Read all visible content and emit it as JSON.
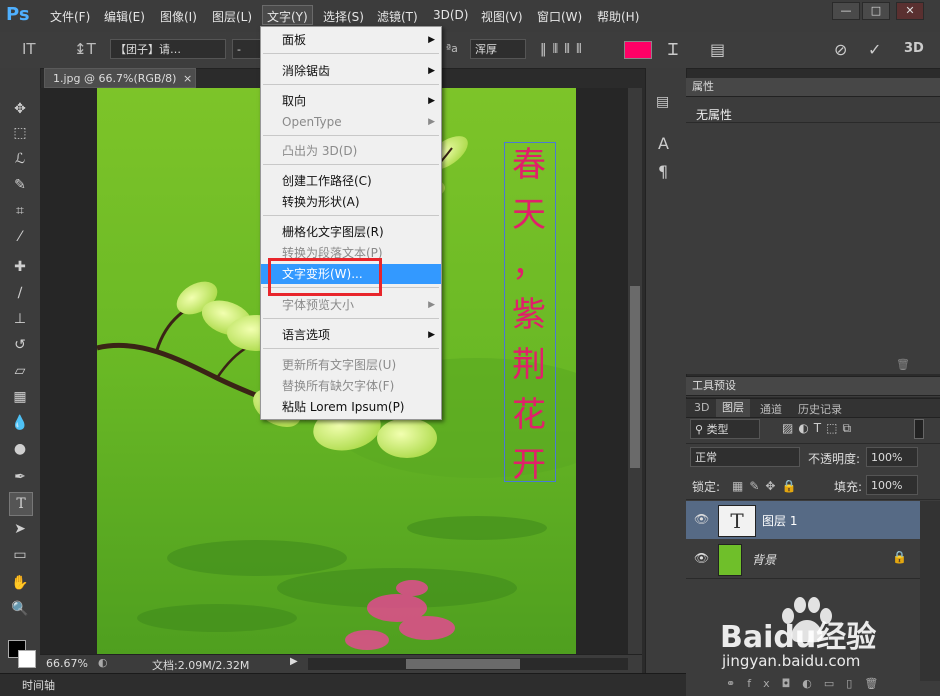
{
  "app": {
    "logo": "Ps"
  },
  "menubar": {
    "items": [
      "文件(F)",
      "编辑(E)",
      "图像(I)",
      "图层(L)",
      "文字(Y)",
      "选择(S)",
      "滤镜(T)",
      "3D(D)",
      "视图(V)",
      "窗口(W)",
      "帮助(H)"
    ],
    "window_controls": [
      "—",
      "□",
      "✕"
    ]
  },
  "options": {
    "font_family": "【团子】请…",
    "font_style": "-",
    "antialias": "浑厚",
    "text_color": "#ff0066"
  },
  "document": {
    "tab_label": "1.jpg @ 66.7%(RGB/8)",
    "close": "×",
    "zoom": "66.67%",
    "doc_size": "文档:2.09M/2.32M"
  },
  "canvas_text": {
    "chars": [
      "春",
      "天",
      "，",
      "紫",
      "荆",
      "花",
      "开"
    ],
    "color": "#e0206a"
  },
  "dropdown": {
    "items": [
      {
        "label": "面板",
        "submenu": true,
        "disabled": false
      },
      {
        "label": "消除锯齿",
        "submenu": true,
        "disabled": false
      },
      {
        "label": "取向",
        "submenu": true,
        "disabled": false
      },
      {
        "label": "OpenType",
        "submenu": true,
        "disabled": true
      },
      {
        "label": "凸出为 3D(D)",
        "submenu": false,
        "disabled": true
      },
      {
        "label": "创建工作路径(C)",
        "submenu": false,
        "disabled": false
      },
      {
        "label": "转换为形状(A)",
        "submenu": false,
        "disabled": false
      },
      {
        "label": "栅格化文字图层(R)",
        "submenu": false,
        "disabled": false
      },
      {
        "label": "转换为段落文本(P)",
        "submenu": false,
        "disabled": true
      },
      {
        "label": "文字变形(W)...",
        "submenu": false,
        "disabled": false,
        "highlighted": true
      },
      {
        "label": "字体预览大小",
        "submenu": true,
        "disabled": true
      },
      {
        "label": "语言选项",
        "submenu": true,
        "disabled": false
      },
      {
        "label": "更新所有文字图层(U)",
        "submenu": false,
        "disabled": true
      },
      {
        "label": "替换所有缺欠字体(F)",
        "submenu": false,
        "disabled": true
      },
      {
        "label": "粘贴 Lorem Ipsum(P)",
        "submenu": false,
        "disabled": false
      }
    ]
  },
  "properties": {
    "tab": "属性",
    "content": "无属性"
  },
  "presets": {
    "tab": "工具预设"
  },
  "layers_panel": {
    "tabs": [
      "3D",
      "图层",
      "通道",
      "历史记录"
    ],
    "filter": "类型",
    "blend_mode": "正常",
    "opacity_label": "不透明度:",
    "opacity": "100%",
    "lock_label": "锁定:",
    "fill_label": "填充:",
    "fill": "100%",
    "layers": [
      {
        "name": "图层 1",
        "type": "text",
        "selected": true
      },
      {
        "name": "背景",
        "type": "image",
        "locked": true
      }
    ]
  },
  "timeline": {
    "label": "时间轴"
  },
  "watermark": {
    "brand": "Baidu经验",
    "url": "jingyan.baidu.com"
  }
}
